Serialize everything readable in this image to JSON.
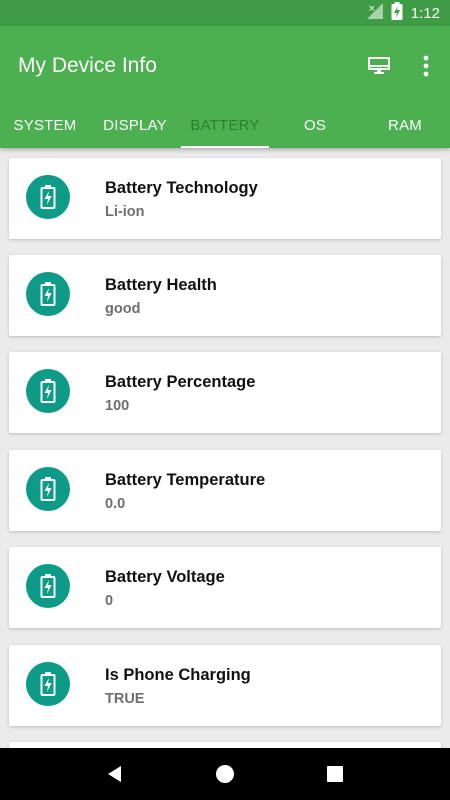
{
  "status_bar": {
    "time": "1:12",
    "signal_icon": "signal-no-data-icon",
    "battery_icon": "battery-charging-icon"
  },
  "app_bar": {
    "title": "My Device Info",
    "actions": [
      {
        "icon": "monitor-icon"
      },
      {
        "icon": "more-vert-icon"
      }
    ]
  },
  "tabs": [
    {
      "label": "SYSTEM",
      "active": false
    },
    {
      "label": "DISPLAY",
      "active": false
    },
    {
      "label": "BATTERY",
      "active": true
    },
    {
      "label": "OS",
      "active": false
    },
    {
      "label": "RAM",
      "active": false
    }
  ],
  "items": [
    {
      "title": "Battery Technology",
      "value": "Li-ion",
      "icon": "battery-charging-icon"
    },
    {
      "title": "Battery Health",
      "value": "good",
      "icon": "battery-charging-icon"
    },
    {
      "title": "Battery Percentage",
      "value": "100",
      "icon": "battery-charging-icon"
    },
    {
      "title": "Battery Temperature",
      "value": "0.0",
      "icon": "battery-charging-icon"
    },
    {
      "title": "Battery Voltage",
      "value": "0",
      "icon": "battery-charging-icon"
    },
    {
      "title": "Is Phone Charging",
      "value": "TRUE",
      "icon": "battery-charging-icon"
    }
  ],
  "colors": {
    "primary": "#4caf50",
    "primary_dark": "#3f9c44",
    "icon_circle": "#0d9a86",
    "active_tab_text": "#2e7d32"
  },
  "nav_bar": {
    "back_icon": "back-icon",
    "home_icon": "home-icon",
    "recents_icon": "recents-icon"
  }
}
